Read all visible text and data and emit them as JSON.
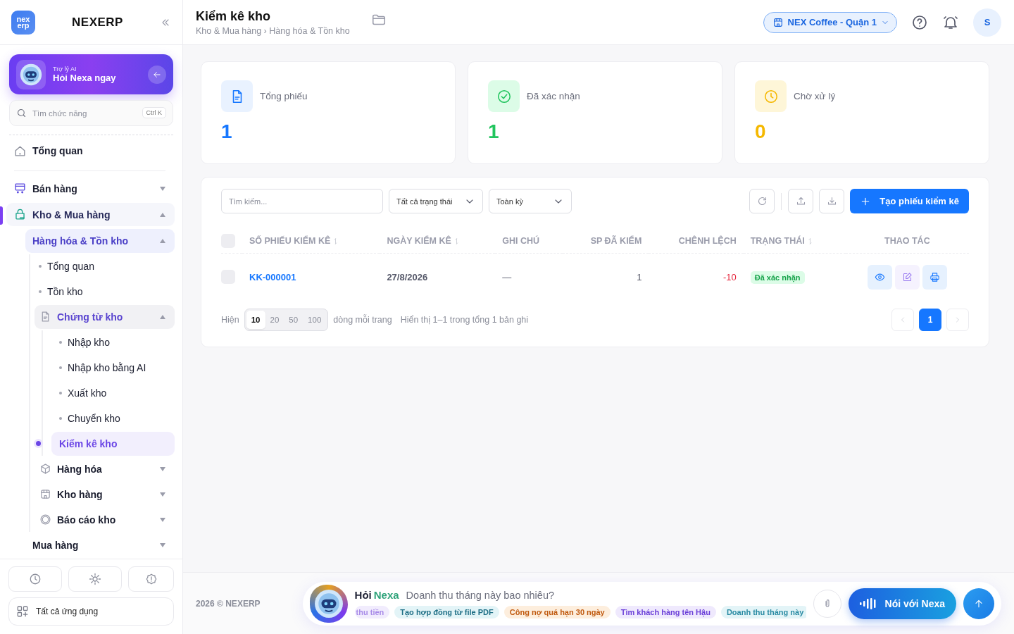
{
  "brand": {
    "logo_top": "nex",
    "logo_bottom": "erp",
    "name": "NEXERP"
  },
  "ai_card": {
    "subtitle": "Trợ lý AI",
    "title": "Hỏi Nexa ngay"
  },
  "sidebar_search": {
    "placeholder": "Tìm chức năng",
    "shortcut": "Ctrl K"
  },
  "nav": {
    "items": [
      {
        "kind": "page",
        "label": "Tổng quan",
        "selected": false
      },
      {
        "kind": "group",
        "label": "Bán hàng",
        "selected": false,
        "expanded": false
      },
      {
        "kind": "group",
        "label": "Kho & Mua hàng",
        "selected": true,
        "expanded": true,
        "children": [
          {
            "kind": "group",
            "label": "Hàng hóa & Tồn kho",
            "selected": true,
            "expanded": true,
            "children": [
              {
                "kind": "link",
                "label": "Tổng quan",
                "selected": false
              },
              {
                "kind": "link",
                "label": "Tồn kho",
                "selected": false
              },
              {
                "kind": "group",
                "label": "Chứng từ kho",
                "selected": true,
                "expanded": true,
                "children": [
                  {
                    "kind": "link",
                    "label": "Nhập kho",
                    "selected": false
                  },
                  {
                    "kind": "link",
                    "label": "Nhập kho bằng AI",
                    "selected": false
                  },
                  {
                    "kind": "link",
                    "label": "Xuất kho",
                    "selected": false
                  },
                  {
                    "kind": "link",
                    "label": "Chuyển kho",
                    "selected": false
                  },
                  {
                    "kind": "link",
                    "label": "Kiểm kê kho",
                    "selected": true
                  }
                ]
              },
              {
                "kind": "group",
                "label": "Hàng hóa",
                "selected": false,
                "expanded": false
              },
              {
                "kind": "group",
                "label": "Kho hàng",
                "selected": false,
                "expanded": false
              },
              {
                "kind": "group",
                "label": "Báo cáo kho",
                "selected": false,
                "expanded": false
              }
            ]
          },
          {
            "kind": "group",
            "label": "Mua hàng",
            "selected": false,
            "expanded": false
          }
        ]
      }
    ]
  },
  "sidebar_footer": {
    "apps_label": "Tất cả ứng dụng"
  },
  "header": {
    "title": "Kiểm kê kho",
    "breadcrumb": "Kho & Mua hàng › Hàng hóa & Tồn kho",
    "store": "NEX Coffee - Quận 1",
    "avatar": "S"
  },
  "stats": [
    {
      "kind": "total",
      "label": "Tổng phiếu",
      "value": "1"
    },
    {
      "kind": "confirmed",
      "label": "Đã xác nhận",
      "value": "1"
    },
    {
      "kind": "pending",
      "label": "Chờ xử lý",
      "value": "0"
    }
  ],
  "toolbar": {
    "search_placeholder": "Tìm kiếm...",
    "filters": [
      "Tất cả trạng thái",
      "Toàn kỳ"
    ],
    "create_button": "Tạo phiếu kiểm kê"
  },
  "table": {
    "select_all_checked": false,
    "columns": [
      {
        "label": "SỐ PHIẾU KIỂM KÊ",
        "sortable": true
      },
      {
        "label": "NGÀY KIỂM KÊ",
        "sortable": true
      },
      {
        "label": "GHI CHÚ",
        "sortable": false
      },
      {
        "label": "SP ĐÃ KIỂM",
        "sortable": false
      },
      {
        "label": "CHÊNH LỆCH",
        "sortable": false
      },
      {
        "label": "TRẠNG THÁI",
        "sortable": true
      },
      {
        "label": "THAO TÁC",
        "sortable": false
      }
    ],
    "rows": [
      {
        "checked": false,
        "code": "KK-000001",
        "date": "27/8/2026",
        "note": "—",
        "counted": "1",
        "difference": "-10",
        "status": {
          "kind": "confirmed",
          "label": "Đã xác nhận"
        }
      }
    ]
  },
  "pagination": {
    "show_label": "Hiện",
    "page_sizes": [
      {
        "label": "10",
        "selected": true
      },
      {
        "label": "20",
        "selected": false
      },
      {
        "label": "50",
        "selected": false
      },
      {
        "label": "100",
        "selected": false
      }
    ],
    "per_page_label": "dòng mỗi trang",
    "summary": "Hiển thị 1–1 trong tổng 1 bản ghi",
    "pages": [
      {
        "label": "1",
        "selected": true
      }
    ]
  },
  "footer": {
    "copyright": "2026 © NEXERP"
  },
  "chat": {
    "ask": "Hỏi",
    "assistant": "Nexa",
    "placeholder": "Doanh thu tháng này bao nhiêu?",
    "voice_button": "Nói với Nexa",
    "suggestions": [
      {
        "label": "thu tiền",
        "color": "#f1ecfd"
      },
      {
        "label": "Tạo hợp đồng từ file PDF",
        "color": "#e3f4f7"
      },
      {
        "label": "Công nợ quá hạn 30 ngày",
        "color": "#fdeedd"
      },
      {
        "label": "Tìm khách hàng tên Hậu",
        "color": "#efe9fd"
      },
      {
        "label": "Doanh thu tháng này",
        "color": "#e3f4f7"
      }
    ]
  }
}
